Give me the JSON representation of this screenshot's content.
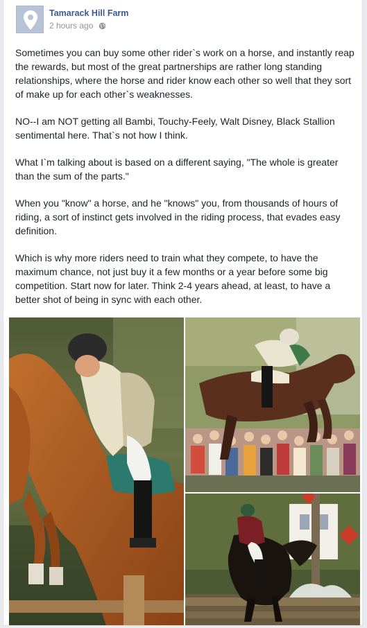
{
  "post": {
    "page_name": "Tamarack Hill Farm",
    "timestamp": "2 hours ago",
    "privacy_icon": "globe-icon",
    "avatar_icon": "map-pin-icon",
    "paragraphs": [
      "Sometimes you can buy some other rider`s work on a horse, and instantly reap the rewards, but most of the great partnerships are rather long standing relationships, where the horse and rider know each other so well that they sort of make up for each other`s weaknesses.",
      "NO--I am NOT getting all Bambi, Touchy-Feely, Walt Disney, Black Stallion sentimental here. That`s not how I think.",
      "What I`m talking about is based on a different saying, \"The whole is greater than the sum of the parts.\"",
      "When you \"know\" a horse, and he \"knows\" you, from thousands of hours of riding, a sort of instinct gets involved in the riding process, that evades easy definition.",
      "Which is why more riders need to train what they compete, to have the maximum chance, not just buy it a few months or a year before some big competition. Start now for later. Think 2-4 years ahead, at least, to have a better shot of being in sync with each other."
    ]
  },
  "colors": {
    "link": "#3b5998",
    "text": "#1d2129",
    "meta": "#90949c",
    "background": "#e9ebee"
  }
}
